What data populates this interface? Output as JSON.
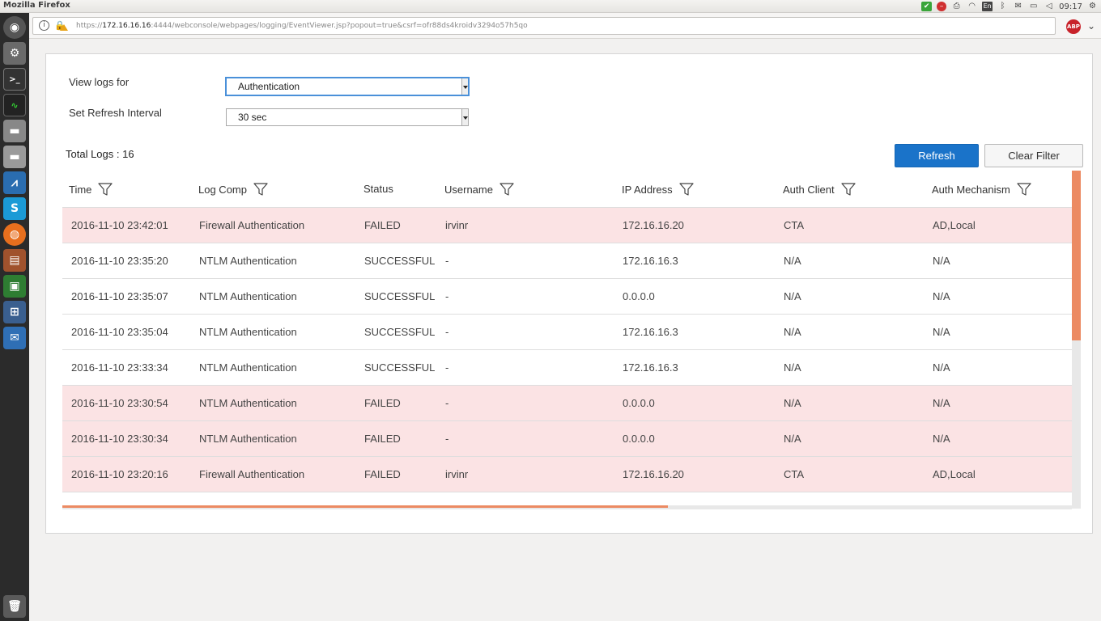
{
  "window": {
    "title": "Mozilla Firefox",
    "clock": "09:17"
  },
  "browser": {
    "url_prefix": "https://",
    "url_host": "172.16.16.16",
    "url_rest": ":4444/webconsole/webpages/logging/EventViewer.jsp?popout=true&csrf=ofr88ds4kroidv3294o57h5qo",
    "abp_label": "ABP",
    "tray_lang": "En"
  },
  "launcher": {
    "items": [
      "ubuntu-dash",
      "settings",
      "terminal",
      "system-monitor",
      "disk",
      "drive",
      "monitor",
      "skype",
      "firefox",
      "files",
      "virtualbox",
      "network",
      "thunderbird",
      "trash"
    ]
  },
  "filters": {
    "view_logs_label": "View logs for",
    "view_logs_value": "Authentication",
    "refresh_label": "Set Refresh Interval",
    "refresh_value": "30 sec"
  },
  "summary": {
    "total_label": "Total Logs : 16"
  },
  "actions": {
    "refresh": "Refresh",
    "clear_filter": "Clear Filter"
  },
  "table": {
    "columns": [
      "Time",
      "Log Comp",
      "Status",
      "Username",
      "IP Address",
      "Auth Client",
      "Auth Mechanism"
    ],
    "filterable": [
      true,
      true,
      false,
      true,
      true,
      true,
      true
    ],
    "rows": [
      {
        "time": "2016-11-10 23:42:01",
        "comp": "Firewall Authentication",
        "status": "FAILED",
        "user": "irvinr",
        "ip": "172.16.16.20",
        "client": "CTA",
        "mech": "AD,Local"
      },
      {
        "time": "2016-11-10 23:35:20",
        "comp": "NTLM Authentication",
        "status": "SUCCESSFUL",
        "user": "-",
        "ip": "172.16.16.3",
        "client": "N/A",
        "mech": "N/A"
      },
      {
        "time": "2016-11-10 23:35:07",
        "comp": "NTLM Authentication",
        "status": "SUCCESSFUL",
        "user": "-",
        "ip": "0.0.0.0",
        "client": "N/A",
        "mech": "N/A"
      },
      {
        "time": "2016-11-10 23:35:04",
        "comp": "NTLM Authentication",
        "status": "SUCCESSFUL",
        "user": "-",
        "ip": "172.16.16.3",
        "client": "N/A",
        "mech": "N/A"
      },
      {
        "time": "2016-11-10 23:33:34",
        "comp": "NTLM Authentication",
        "status": "SUCCESSFUL",
        "user": "-",
        "ip": "172.16.16.3",
        "client": "N/A",
        "mech": "N/A"
      },
      {
        "time": "2016-11-10 23:30:54",
        "comp": "NTLM Authentication",
        "status": "FAILED",
        "user": "-",
        "ip": "0.0.0.0",
        "client": "N/A",
        "mech": "N/A"
      },
      {
        "time": "2016-11-10 23:30:34",
        "comp": "NTLM Authentication",
        "status": "FAILED",
        "user": "-",
        "ip": "0.0.0.0",
        "client": "N/A",
        "mech": "N/A"
      },
      {
        "time": "2016-11-10 23:20:16",
        "comp": "Firewall Authentication",
        "status": "FAILED",
        "user": "irvinr",
        "ip": "172.16.16.20",
        "client": "CTA",
        "mech": "AD,Local"
      },
      {
        "time": "",
        "comp": "",
        "status": "",
        "user": "",
        "ip": "",
        "client": "",
        "mech": ""
      }
    ]
  },
  "colors": {
    "accent": "#1a73c9",
    "failed_row": "#fbe3e4",
    "scroll_thumb": "#ec8a62"
  }
}
